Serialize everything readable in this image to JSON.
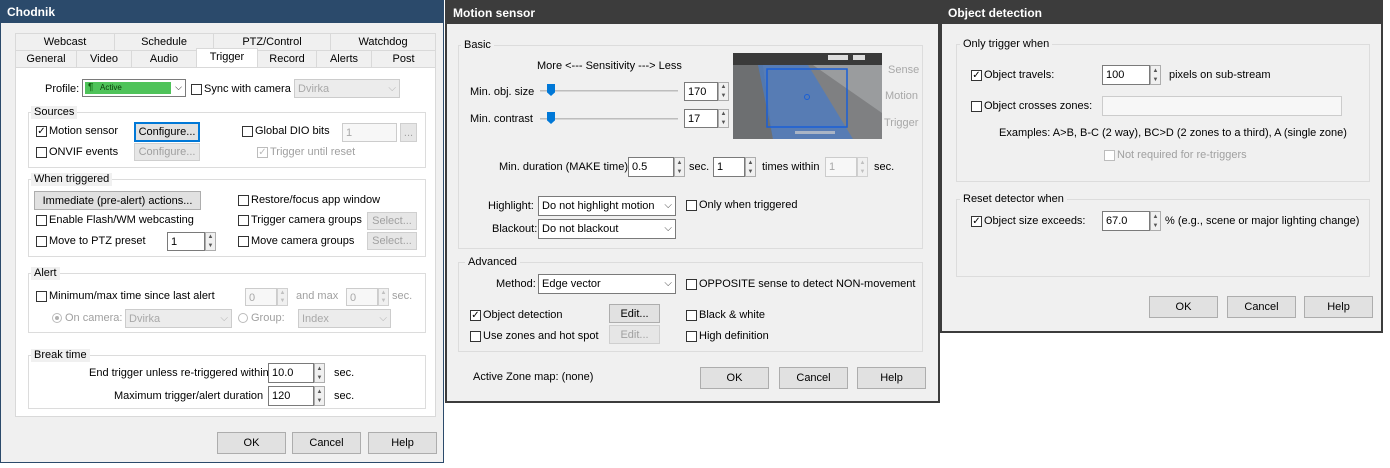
{
  "left": {
    "title": "Chodnik",
    "tabs_row1": [
      "Webcast",
      "Schedule",
      "PTZ/Control",
      "Watchdog"
    ],
    "tabs_row2": [
      "General",
      "Video",
      "Audio",
      "Trigger",
      "Record",
      "Alerts",
      "Post"
    ],
    "profile_label": "Profile:",
    "profile_value": "Active",
    "profile_icon": "¶",
    "sync_label": "Sync with camera",
    "sync_camera": "Dvirka",
    "sources": {
      "title": "Sources",
      "motion": "Motion sensor",
      "configure1": "Configure...",
      "onvif": "ONVIF events",
      "configure2": "Configure...",
      "dio": "Global DIO bits",
      "dio_value": "1",
      "dio_btn": "...",
      "until_reset": "Trigger until reset"
    },
    "when": {
      "title": "When triggered",
      "immediate": "Immediate (pre-alert) actions...",
      "restore": "Restore/focus app window",
      "flash": "Enable Flash/WM webcasting",
      "trig_groups": "Trigger camera groups",
      "select1": "Select...",
      "ptz": "Move to PTZ preset",
      "ptz_value": "1",
      "move_groups": "Move camera groups",
      "select2": "Select..."
    },
    "alert": {
      "title": "Alert",
      "minmax": "Minimum/max time since last alert",
      "min_value": "0",
      "and_max": "and max",
      "max_value": "0",
      "sec": "sec.",
      "on_camera": "On camera:",
      "camera": "Dvirka",
      "group": "Group:",
      "group_value": "Index"
    },
    "break": {
      "title": "Break time",
      "end_label": "End trigger unless re-triggered within",
      "end_value": "10.0",
      "sec1": "sec.",
      "max_label": "Maximum trigger/alert duration",
      "max_value": "120",
      "sec2": "sec."
    },
    "buttons": {
      "ok": "OK",
      "cancel": "Cancel",
      "help": "Help"
    }
  },
  "mid": {
    "title": "Motion sensor",
    "basic": {
      "title": "Basic",
      "sens": "More <--- Sensitivity ---> Less",
      "min_obj": "Min. obj. size",
      "min_obj_value": "170",
      "min_contrast": "Min. contrast",
      "min_contrast_value": "17",
      "prev_sense": "Sense",
      "prev_motion": "Motion",
      "prev_trigger": "Trigger",
      "duration_label": "Min. duration (MAKE time):",
      "duration_value": "0.5",
      "sec1": "sec.",
      "times_value": "1",
      "times_within": "times within",
      "within_value": "1",
      "sec2": "sec.",
      "highlight_label": "Highlight:",
      "highlight_value": "Do not highlight motion",
      "only_when": "Only when triggered",
      "blackout_label": "Blackout:",
      "blackout_value": "Do not blackout"
    },
    "advanced": {
      "title": "Advanced",
      "method_label": "Method:",
      "method_value": "Edge vector",
      "opposite": "OPPOSITE sense to detect NON-movement",
      "objdet": "Object detection",
      "edit1": "Edit...",
      "bw": "Black & white",
      "zones": "Use zones and hot spot",
      "edit2": "Edit...",
      "hd": "High definition"
    },
    "zone_map": "Active Zone map:  (none)",
    "buttons": {
      "ok": "OK",
      "cancel": "Cancel",
      "help": "Help"
    }
  },
  "right": {
    "title": "Object detection",
    "only": {
      "title": "Only trigger when",
      "travels": "Object travels:",
      "travels_value": "100",
      "pixels": "pixels on sub-stream",
      "crosses": "Object crosses zones:",
      "examples": "Examples:  A>B, B-C (2 way), BC>D (2 zones to a third), A (single zone)",
      "not_required": "Not required for re-triggers"
    },
    "reset": {
      "title": "Reset detector when",
      "exceeds": "Object size exceeds:",
      "exceeds_value": "67.0",
      "pct": "% (e.g., scene or major lighting change)"
    },
    "buttons": {
      "ok": "OK",
      "cancel": "Cancel",
      "help": "Help"
    }
  },
  "colors": {
    "title_left": "#2b4a6b",
    "title_dark": "#3c3c3c",
    "profile_green": "#4fc35a",
    "focus_blue": "#0078d7"
  }
}
